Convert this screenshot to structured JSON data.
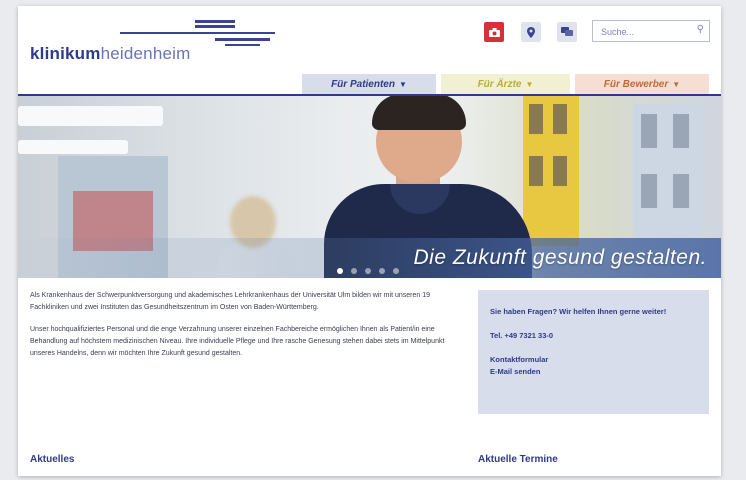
{
  "logo": {
    "bold": "klinikum",
    "light": "heidenheim"
  },
  "header": {
    "icons": [
      "camera-icon",
      "map-pin-icon",
      "chat-icon"
    ],
    "search": {
      "placeholder": "Suche...",
      "icon": "search-icon"
    }
  },
  "nav": {
    "tabs": [
      {
        "label": "Für Patienten",
        "color": "#2e3a8c"
      },
      {
        "label": "Für Ärzte",
        "color": "#b9ad38"
      },
      {
        "label": "Für Bewerber",
        "color": "#c46a3a"
      }
    ]
  },
  "hero": {
    "slogan": "Die Zukunft gesund gestalten.",
    "slide_count": 5,
    "active_slide": 1
  },
  "intro": {
    "p1": "Als Krankenhaus der Schwerpunktversorgung und akademisches Lehrkrankenhaus der Universität Ulm bilden wir mit unseren 19 Fachkliniken und zwei Instituten das Gesundheitszentrum im Osten von Baden-Württemberg.",
    "p2": "Unser hochqualifiziertes Personal und die enge Verzahnung unserer einzelnen Fachbereiche ermöglichen Ihnen als Patient/in eine Behandlung auf höchstem medizinischen Niveau. Ihre individuelle Pflege und Ihre rasche Genesung stehen dabei stets im Mittelpunkt unseres Handelns, denn wir möchten Ihre Zukunft gesund gestalten."
  },
  "contact": {
    "question": "Sie haben Fragen? Wir helfen Ihnen gerne weiter!",
    "phone": "Tel. +49 7321 33-0",
    "links": [
      "Kontaktformular",
      "E-Mail senden"
    ]
  },
  "sections": {
    "news": "Aktuelles",
    "events": "Aktuelle Termine"
  },
  "colors": {
    "brand": "#2e3a8c",
    "accent_red": "#d8303a"
  }
}
